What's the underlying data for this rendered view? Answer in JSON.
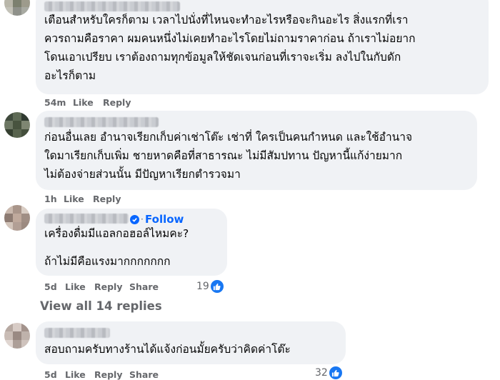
{
  "comments": [
    {
      "text": "เตือนสำหรับใครก็ตาม เวลาไปนั่งที่ไหนจะทำอะไรหรือจะกินอะไร สิ่งแรกที่เรา\nควรถามคือราคา ผมคนหนึ่งไม่เคยทำอะไรโดยไม่ถามราคาก่อน ถ้าเราไม่อยาก\nโดนเอาเปรียบ เราต้องถามทุกข้อมูลให้ชัดเจนก่อนที่เราจะเริ่ม ลงไปในกับดัก\nอะไรก็ตาม",
      "time": "54m",
      "like": "Like",
      "reply": "Reply"
    },
    {
      "text": "ก่อนอื่นเลย อำนาจเรียกเก็บค่าเช่าโต๊ะ เช่าที่ ใครเป็นคนกำหนด และใช้อำนาจ\nใดมาเรียกเก็บเพิ่ม ชายหาดคือที่สาธารณะ ไม่มีสัมปทาน ปัญหานี้แก้ง่ายมาก\nไม่ต้องจ่ายส่วนนั้น มีปัญหาเรียกตำรวจมา",
      "time": "1h",
      "like": "Like",
      "reply": "Reply"
    },
    {
      "follow": "Follow",
      "line1": "เครื่องดื่มมีแอลกอฮอล์ไหมคะ?",
      "line2": "ถ้าไม่มีคือแรงมากกกกกกก",
      "time": "5d",
      "like": "Like",
      "reply": "Reply",
      "share": "Share",
      "reactions": "19"
    },
    {
      "text": "สอบถามครับทางร้านได้แจ้งก่อนมั้ยครับว่าคิดค่าโต๊ะ",
      "time": "5d",
      "like": "Like",
      "reply": "Reply",
      "share": "Share",
      "reactions": "32"
    }
  ],
  "view_replies": "View all 14 replies",
  "colors": {
    "bubble": "#f0f2f5",
    "meta": "#65676b",
    "link": "#0866ff",
    "like_badge": "#1877f2"
  },
  "icons": [
    "thumbs-up-icon",
    "verified-badge-icon"
  ]
}
